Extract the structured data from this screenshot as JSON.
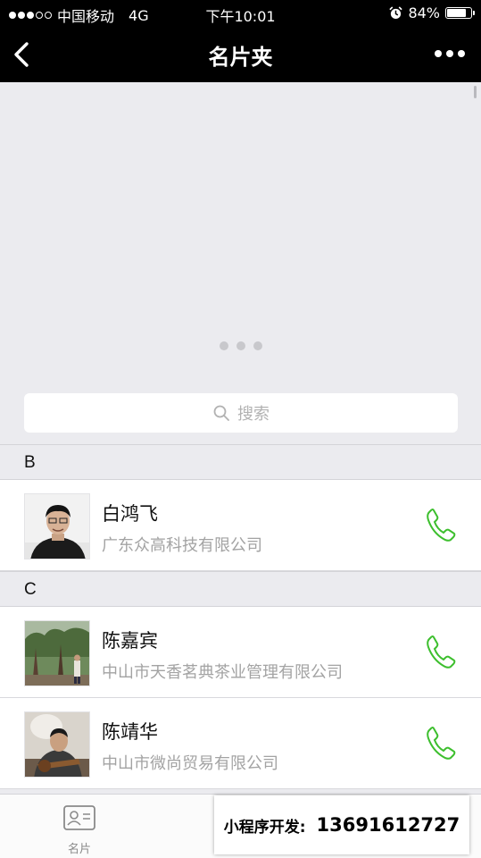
{
  "status_bar": {
    "carrier": "中国移动",
    "network": "4G",
    "time": "下午10:01",
    "battery": "84%",
    "battery_level": 0.84
  },
  "nav": {
    "title": "名片夹"
  },
  "search": {
    "placeholder": "搜索"
  },
  "sections": [
    {
      "letter": "B",
      "contacts": [
        {
          "name": "白鸿飞",
          "company": "广东众高科技有限公司"
        }
      ]
    },
    {
      "letter": "C",
      "contacts": [
        {
          "name": "陈嘉宾",
          "company": "中山市天香茗典茶业管理有限公司"
        },
        {
          "name": "陈靖华",
          "company": "中山市微尚贸易有限公司"
        }
      ]
    }
  ],
  "tabbar": {
    "cards_label": "名片"
  },
  "promo": {
    "label": "小程序开发:",
    "phone": "13691612727"
  },
  "colors": {
    "accent_green": "#3dbf2e",
    "bar_black": "#000000",
    "background": "#ebebef"
  },
  "icons": [
    "back-arrow-icon",
    "more-dots-icon",
    "search-icon",
    "phone-icon",
    "business-card-icon",
    "alarm-icon",
    "battery-icon"
  ]
}
